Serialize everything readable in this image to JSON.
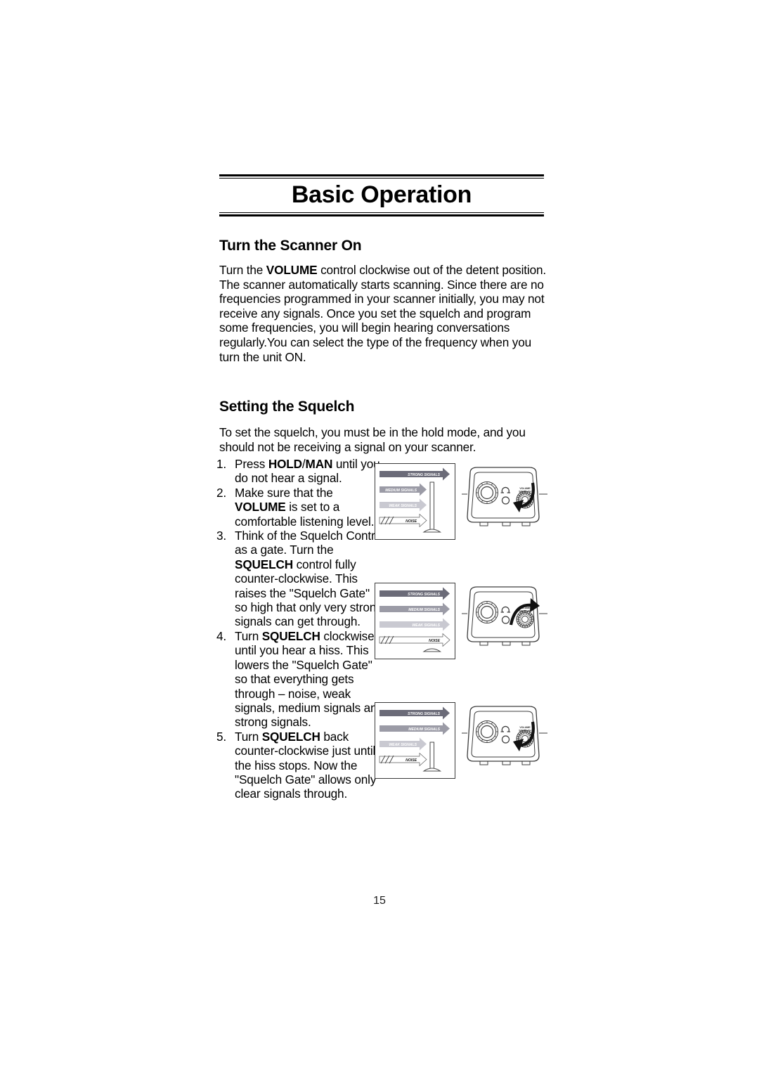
{
  "document": {
    "chapter_title": "Basic Operation",
    "page_number": "15"
  },
  "sections": [
    {
      "heading": "Turn the Scanner On",
      "paragraph_html": "Turn the <b>VOLUME</b> control clockwise out of the detent position. The scanner automatically starts scanning. Since there are no frequencies programmed in your scanner initially, you may not receive any signals. Once you set the squelch and program some frequencies, you will begin hearing conversations regularly.You can select the type of the frequency when you turn the unit ON."
    },
    {
      "heading": "Setting the Squelch",
      "paragraph_html": "To set the squelch, you must be in the hold mode, and you should not be receiving a signal on your scanner."
    }
  ],
  "steps": [
    {
      "number": "1.",
      "text_html": "Press <b>HOLD</b>/<b>MAN</b> until you do not hear a signal."
    },
    {
      "number": "2.",
      "text_html": "Make sure that the <b>VOLUME</b> is set to a comfortable listening level."
    },
    {
      "number": "3.",
      "text_html": "Think of the Squelch Control as a gate. Turn the <b>SQUELCH</b> control fully counter-clockwise. This raises the \"Squelch Gate\" so high that only very strong signals can get through."
    },
    {
      "number": "4.",
      "text_html": "Turn <b>SQUELCH</b> clockwise until you hear a hiss. This lowers the \"Squelch Gate\" so that everything gets through &#8211; noise, weak signals, medium signals and strong signals."
    },
    {
      "number": "5.",
      "text_html": "Turn <b>SQUELCH</b> back counter-clockwise just until the hiss stops. Now the \"Squelch Gate\" allows only clear signals through."
    }
  ],
  "figures": [
    {
      "id": "figure-squelch-gate-high",
      "caption_role": "squelch gate raised high - only strong signals pass",
      "arrows": [
        {
          "label": "STRONG SIGNALS",
          "color": "#6b6b78",
          "passes": true
        },
        {
          "label": "MEDIUM SIGNALS",
          "color": "#9b9ba6",
          "passes": false
        },
        {
          "label": "WEAK SIGNALS",
          "color": "#c9c9d1",
          "passes": false
        },
        {
          "label": "NOISE",
          "color": "#ffffff",
          "passes": false
        }
      ],
      "gate_height": "high",
      "unit": {
        "knob_label": "VOLUME SQUELCH",
        "rotation": "counter-clockwise",
        "headphone_icon": "headphone-jack-icon"
      }
    },
    {
      "id": "figure-squelch-gate-low",
      "caption_role": "squelch gate lowered - all signals pass",
      "arrows": [
        {
          "label": "STRONG SIGNALS",
          "color": "#6b6b78",
          "passes": true
        },
        {
          "label": "MEDIUM SIGNALS",
          "color": "#9b9ba6",
          "passes": true
        },
        {
          "label": "WEAK SIGNALS",
          "color": "#c9c9d1",
          "passes": true
        },
        {
          "label": "NOISE",
          "color": "#ffffff",
          "passes": true
        }
      ],
      "gate_height": "down",
      "unit": {
        "knob_label": "VOLUME SQUELCH",
        "rotation": "clockwise",
        "headphone_icon": "headphone-jack-icon"
      }
    },
    {
      "id": "figure-squelch-gate-medium",
      "caption_role": "squelch gate at medium - strong and medium signals pass",
      "arrows": [
        {
          "label": "STRONG SIGNALS",
          "color": "#6b6b78",
          "passes": true
        },
        {
          "label": "MEDIUM SIGNALS",
          "color": "#9b9ba6",
          "passes": true
        },
        {
          "label": "WEAK SIGNALS",
          "color": "#c9c9d1",
          "passes": false
        },
        {
          "label": "NOISE",
          "color": "#ffffff",
          "passes": false
        }
      ],
      "gate_height": "medium",
      "unit": {
        "knob_label": "VOLUME SQUELCH",
        "rotation": "counter-clockwise",
        "headphone_icon": "headphone-jack-icon"
      }
    }
  ]
}
